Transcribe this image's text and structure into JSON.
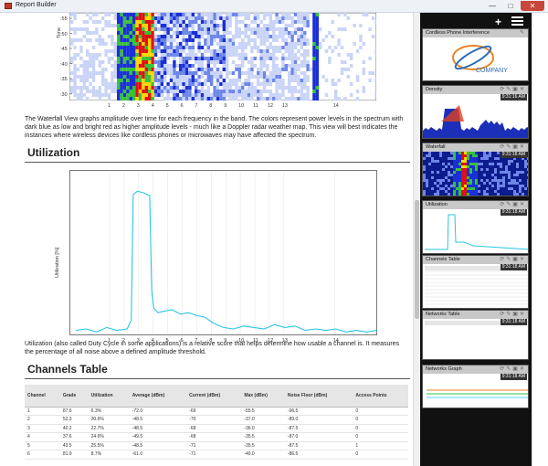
{
  "window": {
    "title": "Report Builder",
    "min": "—",
    "max": "□",
    "close": "✕"
  },
  "waterfall": {
    "ylabel": "Time",
    "yticks": [
      ":55",
      ":50",
      ":45",
      ":40",
      ":35",
      ":30"
    ],
    "xticks": [
      "1",
      "2",
      "3",
      "4",
      "5",
      "6",
      "7",
      "8",
      "9",
      "10",
      "11",
      "12",
      "13",
      "14"
    ],
    "description": "The Waterfall View graphs amplitude over time for each frequency in the band. The colors represent power levels in the spectrum with dark blue as low and bright red as higher amplitude levels - much like a Doppler radar weather map. This view will best indicates the instances where wireless devices like cordless phones or microwaves may have affected the spectrum."
  },
  "utilization": {
    "heading": "Utilization",
    "description": "Utilization (also called Duty Cycle in some applications) is a relative score that helps determine how usable a channel is. It measures the percentage of all noise above a defined amplitude threshold."
  },
  "chart_data": {
    "type": "line",
    "ylabel": "Utilization [%]",
    "xlabel": "",
    "categories": [
      "1",
      "2",
      "3",
      "4",
      "5",
      "6",
      "7",
      "8",
      "9",
      "10",
      "11",
      "12",
      "13",
      "14"
    ],
    "xlim": [
      0,
      15
    ],
    "ylim": [
      0,
      100
    ],
    "grid": "vertical",
    "series": [
      {
        "color": "#29c5e6",
        "x": [
          0.3,
          0.8,
          1.3,
          1.8,
          2.3,
          2.8,
          3.0,
          3.1,
          3.3,
          3.6,
          3.9,
          4.0,
          4.1,
          4.3,
          4.6,
          5.0,
          5.4,
          5.8,
          6.2,
          6.6,
          7.0,
          7.5,
          8.0,
          8.5,
          9.0,
          9.5,
          10.0,
          10.5,
          11.0,
          11.5,
          12.0,
          12.5,
          13.0,
          13.5,
          14.0,
          14.5,
          15.0
        ],
        "y": [
          3,
          4,
          2,
          5,
          3,
          4,
          10,
          95,
          97,
          96,
          94,
          30,
          18,
          15,
          16,
          17,
          14,
          15,
          13,
          12,
          8,
          5,
          4,
          6,
          5,
          4,
          7,
          5,
          6,
          3,
          4,
          3,
          4,
          2,
          3,
          2,
          3
        ]
      }
    ]
  },
  "channels": {
    "heading": "Channels Table",
    "columns": [
      "Channel",
      "Grade",
      "Utilization",
      "Average (dBm)",
      "Current (dBm)",
      "Max (dBm)",
      "Noise Floor (dBm)",
      "Access Points"
    ],
    "rows": [
      [
        "1",
        "87.6",
        "6.3%",
        "-72.0",
        "-69",
        "-55.5",
        "-96.5",
        "0"
      ],
      [
        "2",
        "52.3",
        "20.6%",
        "-48.5",
        "-70",
        "-37.0",
        "-89.0",
        "0"
      ],
      [
        "3",
        "40.2",
        "22.7%",
        "-48.5",
        "-68",
        "-36.0",
        "-87.5",
        "0"
      ],
      [
        "4",
        "37.6",
        "24.6%",
        "-49.5",
        "-68",
        "-35.5",
        "-87.0",
        "0"
      ],
      [
        "5",
        "43.5",
        "25.5%",
        "-48.5",
        "-71",
        "-35.5",
        "-87.5",
        "1"
      ],
      [
        "6",
        "81.9",
        "8.7%",
        "-61.0",
        "-71",
        "-40.0",
        "-86.5",
        "0"
      ]
    ]
  },
  "sidebar": {
    "add_label": "+",
    "logo_text": "COMPANY",
    "cards": [
      {
        "title": "Cordless Phone Interference",
        "time": ""
      },
      {
        "title": "Density",
        "time": "9:31:16 AM"
      },
      {
        "title": "Waterfall",
        "time": "9:31:18 AM"
      },
      {
        "title": "Utilization",
        "time": "9:31:18 AM"
      },
      {
        "title": "Channels Table",
        "time": "9:31:18 AM"
      },
      {
        "title": "Networks Table",
        "time": "9:31:18 AM"
      },
      {
        "title": "Networks Graph",
        "time": "9:31:18 AM"
      }
    ]
  },
  "colors": {
    "accent": "#29c5e6",
    "sidebar": "#111111",
    "close": "#c9473a"
  }
}
